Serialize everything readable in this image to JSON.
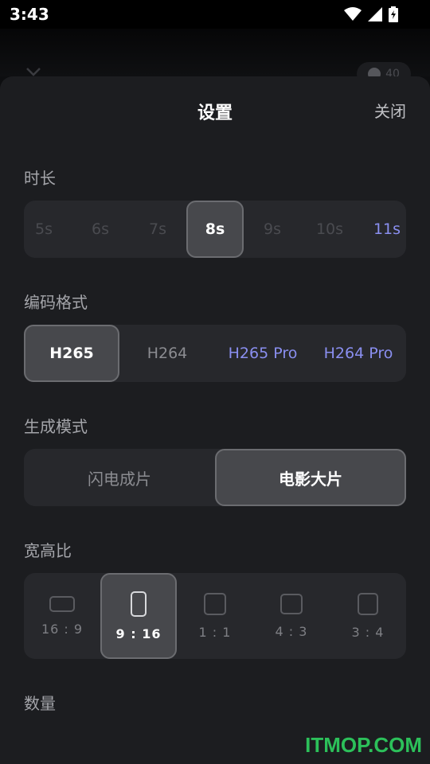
{
  "status_bar": {
    "time": "3:43"
  },
  "background": {
    "pill_count": "40"
  },
  "sheet": {
    "title": "设置",
    "close_label": "关闭"
  },
  "duration": {
    "label": "时长",
    "options": [
      "5s",
      "6s",
      "7s",
      "8s",
      "9s",
      "10s",
      "11s"
    ],
    "selected": "8s"
  },
  "codec": {
    "label": "编码格式",
    "options": [
      "H265",
      "H264",
      "H265 Pro",
      "H264 Pro"
    ],
    "selected": "H265"
  },
  "mode": {
    "label": "生成模式",
    "options": [
      "闪电成片",
      "电影大片"
    ],
    "selected": "电影大片"
  },
  "aspect_ratio": {
    "label": "宽高比",
    "options": [
      "16 : 9",
      "9 : 16",
      "1 : 1",
      "4 : 3",
      "3 : 4"
    ],
    "selected": "9 : 16"
  },
  "quantity": {
    "label": "数量"
  },
  "watermark": "ITMOP.COM",
  "colors": {
    "accent": "#8a8ff0",
    "sheet_bg": "#1c1d20",
    "segment_bg": "#27282c",
    "selected_bg": "#47484c",
    "watermark": "#2cc05a"
  }
}
